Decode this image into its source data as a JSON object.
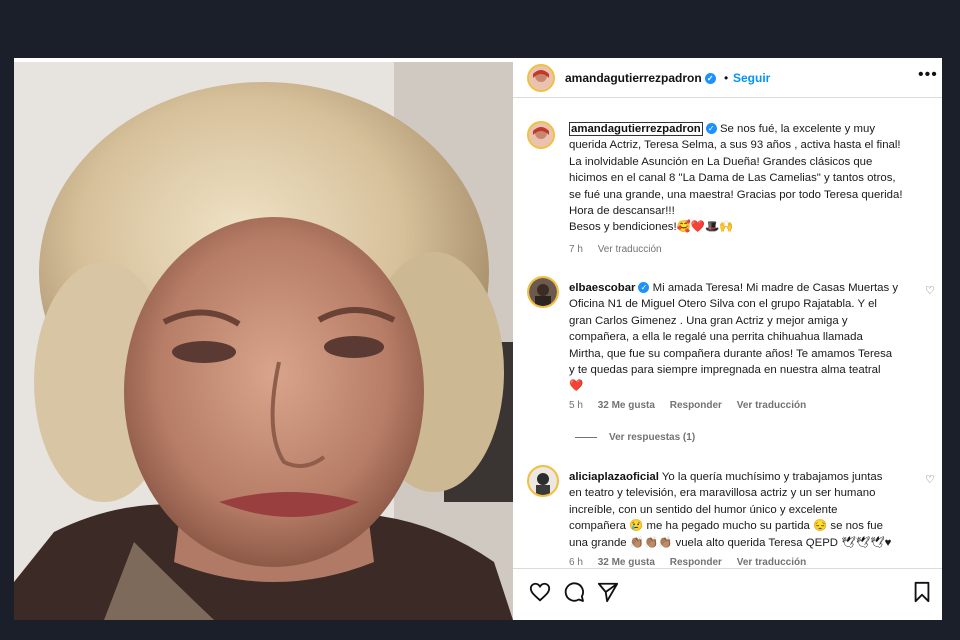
{
  "post": {
    "author": "amandagutierrezpadron",
    "follow_label": "Seguir",
    "separator": "•",
    "more_label": "•••"
  },
  "caption": {
    "username": "amandagutierrezpadron",
    "line1": "Se nos fué, la excelente y muy",
    "line2": "querida Actriz, Teresa Selma, a sus 93 años , activa hasta el final!",
    "line3": "La inolvidable Asunción en La Dueña! Grandes clásicos que",
    "line4": "hicimos en el canal 8 \"La Dama de Las Camelias\" y tantos otros,",
    "line5": "se fué una grande, una maestra! Gracias por todo Teresa querida!",
    "line6": "Hora de descansar!!!",
    "line7": "Besos y bendiciones!🥰❤️🎩🙌",
    "time": "7 h",
    "translate": "Ver traducción"
  },
  "comments": [
    {
      "username": "elbaescobar",
      "lines": [
        "Mi amada Teresa! Mi madre de Casas Muertas y",
        "Oficina N1 de Miguel Otero Silva con el grupo Rajatabla. Y el",
        "gran Carlos Gimenez . Una gran Actriz y mejor amiga y",
        "compañera, a ella le regalé una perrita chihuahua llamada",
        "Mirtha, que fue su compañera durante años! Te amamos Teresa",
        "y te quedas para siempre impregnada en nuestra alma teatral",
        "❤️"
      ],
      "time": "5 h",
      "likes": "32 Me gusta",
      "reply": "Responder",
      "translate": "Ver traducción",
      "view_replies": "Ver respuestas (1)"
    },
    {
      "username": "aliciaplazaoficial",
      "lines": [
        "Yo la quería muchísimo y trabajamos juntas",
        "en teatro y televisión, era maravillosa actriz y un ser humano",
        "increíble, con un sentido del humor único y excelente",
        "compañera 😢 me ha pegado mucho su partida 😔 se nos fue",
        "una grande 👏🏽👏🏽👏🏽 vuela alto querida Teresa QEPD 🕊🕊🕊♥"
      ],
      "time": "6 h",
      "likes": "32 Me gusta",
      "reply": "Responder",
      "translate": "Ver traducción"
    }
  ],
  "actions": {
    "like_icon": "heart-icon",
    "comment_icon": "comment-icon",
    "share_icon": "share-icon",
    "save_icon": "bookmark-icon"
  },
  "colors": {
    "accent": "#0095f6",
    "verified": "#1e90ff",
    "background": "#1b1f2a"
  }
}
